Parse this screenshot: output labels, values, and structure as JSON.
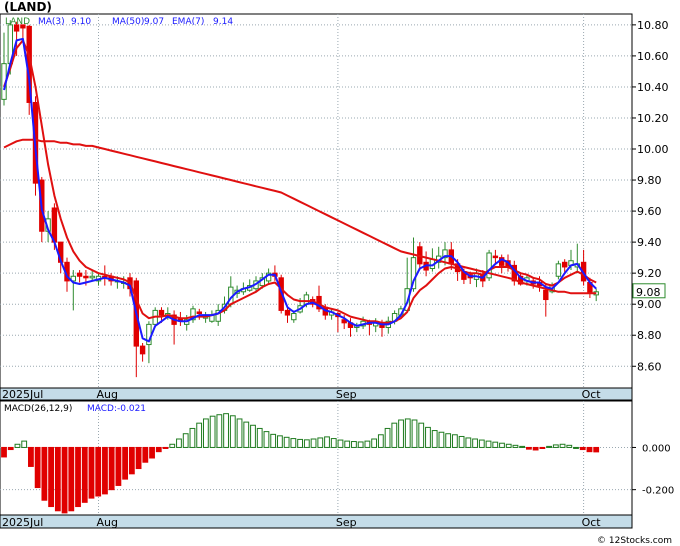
{
  "title": "(LAND)",
  "legend": {
    "symbol": "LAND",
    "ma3_label": "MA(3)",
    "ma3_value": "9.10",
    "ma50_label": "MA(50)",
    "ma50_value": "9.07",
    "ema7_label": "EMA(7)",
    "ema7_value": "9.14"
  },
  "last_price_label": "9.08",
  "macd_legend": {
    "label": "MACD(26,12,9)",
    "value_label": "MACD:-0.021"
  },
  "x_axis_labels": [
    "2025Jul",
    "Aug",
    "Sep",
    "Oct"
  ],
  "footer": "© 12Stocks.com",
  "colors": {
    "up": "#2e8b2e",
    "down": "#e00000",
    "ma3": "#1a1aff",
    "ma50": "#e01010",
    "ema7": "#e01010",
    "axis_bar": "#c4dce8",
    "grid": "#9aa8b0",
    "macd_neg": "#e00000",
    "macd_pos": "#1e7a1e"
  },
  "chart_data": [
    {
      "type": "candlestick",
      "title": "(LAND)",
      "y_ticks": [
        10.8,
        10.6,
        10.4,
        10.2,
        10.0,
        9.8,
        9.6,
        9.4,
        9.2,
        9.0,
        8.8,
        8.6
      ],
      "ylim": [
        8.46,
        10.87
      ],
      "month_labels": [
        {
          "label": "2025Jul",
          "index": 0
        },
        {
          "label": "Aug",
          "index": 15
        },
        {
          "label": "Sep",
          "index": 53
        },
        {
          "label": "Oct",
          "index": 92
        }
      ],
      "series_legend": [
        "MA(3) 9.10",
        "MA(50) 9.07",
        "EMA(7) 9.14"
      ],
      "last_price": 9.08,
      "candles": [
        [
          10.32,
          10.55,
          10.75,
          10.28
        ],
        [
          10.55,
          10.8,
          10.83,
          10.48
        ],
        [
          10.8,
          10.76,
          10.82,
          10.6
        ],
        [
          10.8,
          10.78,
          10.8,
          10.7
        ],
        [
          10.79,
          10.3,
          10.8,
          10.22
        ],
        [
          10.3,
          9.78,
          10.34,
          9.7
        ],
        [
          9.8,
          9.47,
          9.82,
          9.4
        ],
        [
          9.47,
          9.55,
          9.6,
          9.4
        ],
        [
          9.62,
          9.4,
          9.65,
          9.35
        ],
        [
          9.4,
          9.27,
          9.4,
          9.2
        ],
        [
          9.27,
          9.15,
          9.3,
          9.08
        ],
        [
          9.15,
          9.18,
          9.22,
          8.96
        ],
        [
          9.2,
          9.18,
          9.22,
          9.14
        ],
        [
          9.18,
          9.17,
          9.22,
          9.12
        ],
        [
          9.17,
          9.18,
          9.22,
          9.15
        ],
        [
          9.15,
          9.18,
          9.2,
          9.12
        ],
        [
          9.18,
          9.17,
          9.25,
          9.12
        ],
        [
          9.18,
          9.15,
          9.2,
          9.12
        ],
        [
          9.15,
          9.15,
          9.18,
          9.1
        ],
        [
          9.14,
          9.14,
          9.18,
          9.1
        ],
        [
          9.17,
          9.1,
          9.2,
          9.05
        ],
        [
          9.15,
          8.73,
          9.17,
          8.53
        ],
        [
          8.73,
          8.68,
          8.75,
          8.63
        ],
        [
          8.74,
          8.87,
          8.89,
          8.62
        ],
        [
          8.87,
          8.96,
          8.98,
          8.85
        ],
        [
          8.96,
          8.93,
          8.98,
          8.88
        ],
        [
          8.92,
          8.94,
          8.98,
          8.9
        ],
        [
          8.93,
          8.87,
          8.96,
          8.74
        ],
        [
          8.91,
          8.89,
          8.95,
          8.86
        ],
        [
          8.87,
          8.9,
          8.93,
          8.83
        ],
        [
          8.9,
          8.97,
          8.99,
          8.88
        ],
        [
          8.95,
          8.94,
          8.97,
          8.9
        ],
        [
          8.91,
          8.92,
          8.95,
          8.88
        ],
        [
          8.89,
          8.93,
          8.96,
          8.88
        ],
        [
          8.89,
          8.96,
          9.0,
          8.86
        ],
        [
          8.96,
          9.0,
          9.05,
          8.94
        ],
        [
          9.0,
          9.11,
          9.18,
          8.98
        ],
        [
          9.07,
          9.09,
          9.12,
          9.04
        ],
        [
          9.08,
          9.1,
          9.14,
          9.06
        ],
        [
          9.09,
          9.12,
          9.16,
          9.08
        ],
        [
          9.1,
          9.15,
          9.18,
          9.08
        ],
        [
          9.12,
          9.17,
          9.2,
          9.1
        ],
        [
          9.15,
          9.2,
          9.23,
          9.13
        ],
        [
          9.2,
          9.18,
          9.25,
          9.15
        ],
        [
          9.17,
          8.96,
          9.19,
          8.94
        ],
        [
          8.96,
          8.93,
          8.98,
          8.88
        ],
        [
          8.9,
          8.94,
          8.96,
          8.88
        ],
        [
          8.95,
          8.99,
          9.04,
          8.94
        ],
        [
          9.0,
          9.06,
          9.08,
          8.98
        ],
        [
          9.03,
          9.0,
          9.05,
          8.98
        ],
        [
          9.05,
          8.97,
          9.12,
          8.95
        ],
        [
          8.98,
          8.93,
          9.0,
          8.9
        ],
        [
          8.93,
          8.95,
          8.97,
          8.9
        ],
        [
          8.94,
          8.92,
          8.95,
          8.82
        ],
        [
          8.9,
          8.88,
          8.93,
          8.84
        ],
        [
          8.88,
          8.85,
          8.91,
          8.79
        ],
        [
          8.85,
          8.86,
          8.88,
          8.82
        ],
        [
          8.86,
          8.89,
          8.92,
          8.84
        ],
        [
          8.89,
          8.87,
          8.9,
          8.8
        ],
        [
          8.86,
          8.89,
          8.91,
          8.82
        ],
        [
          8.88,
          8.85,
          8.9,
          8.79
        ],
        [
          8.85,
          8.89,
          8.92,
          8.81
        ],
        [
          8.89,
          8.94,
          8.96,
          8.87
        ],
        [
          8.93,
          8.97,
          8.99,
          8.91
        ],
        [
          8.96,
          9.1,
          9.3,
          8.95
        ],
        [
          9.1,
          9.3,
          9.43,
          9.08
        ],
        [
          9.37,
          9.26,
          9.4,
          9.22
        ],
        [
          9.27,
          9.22,
          9.34,
          9.18
        ],
        [
          9.23,
          9.29,
          9.36,
          9.21
        ],
        [
          9.27,
          9.31,
          9.37,
          9.23
        ],
        [
          9.3,
          9.35,
          9.4,
          9.25
        ],
        [
          9.35,
          9.26,
          9.4,
          9.22
        ],
        [
          9.26,
          9.21,
          9.29,
          9.15
        ],
        [
          9.21,
          9.16,
          9.23,
          9.13
        ],
        [
          9.19,
          9.17,
          9.21,
          9.13
        ],
        [
          9.16,
          9.2,
          9.23,
          9.11
        ],
        [
          9.19,
          9.15,
          9.22,
          9.11
        ],
        [
          9.17,
          9.33,
          9.35,
          9.15
        ],
        [
          9.31,
          9.3,
          9.35,
          9.26
        ],
        [
          9.3,
          9.25,
          9.32,
          9.2
        ],
        [
          9.28,
          9.24,
          9.32,
          9.21
        ],
        [
          9.25,
          9.15,
          9.28,
          9.12
        ],
        [
          9.18,
          9.13,
          9.2,
          9.12
        ],
        [
          9.15,
          9.17,
          9.19,
          9.12
        ],
        [
          9.15,
          9.13,
          9.17,
          9.1
        ],
        [
          9.14,
          9.12,
          9.18,
          9.08
        ],
        [
          9.09,
          9.03,
          9.13,
          8.92
        ],
        [
          9.08,
          9.12,
          9.14,
          9.07
        ],
        [
          9.18,
          9.26,
          9.28,
          9.16
        ],
        [
          9.27,
          9.24,
          9.29,
          9.2
        ],
        [
          9.25,
          9.28,
          9.35,
          9.22
        ],
        [
          9.24,
          9.26,
          9.39,
          9.2
        ],
        [
          9.27,
          9.15,
          9.35,
          9.12
        ],
        [
          9.14,
          9.07,
          9.17,
          9.04
        ],
        [
          9.06,
          9.08,
          9.1,
          9.02
        ]
      ],
      "ma3": [
        10.38,
        10.55,
        10.7,
        10.71,
        10.45,
        10.0,
        9.61,
        9.48,
        9.4,
        9.28,
        9.18,
        9.14,
        9.13,
        9.14,
        9.15,
        9.16,
        9.17,
        9.16,
        9.15,
        9.14,
        9.12,
        8.94,
        8.78,
        8.76,
        8.86,
        8.89,
        8.92,
        8.9,
        8.89,
        8.89,
        8.91,
        8.93,
        8.93,
        8.93,
        8.94,
        8.98,
        9.04,
        9.08,
        9.1,
        9.11,
        9.13,
        9.16,
        9.19,
        9.19,
        9.08,
        8.98,
        8.95,
        8.97,
        9.0,
        9.01,
        8.99,
        8.96,
        8.95,
        8.93,
        8.91,
        8.88,
        8.86,
        8.87,
        8.88,
        8.88,
        8.87,
        8.87,
        8.89,
        8.93,
        9.01,
        9.15,
        9.23,
        9.25,
        9.25,
        9.28,
        9.31,
        9.31,
        9.27,
        9.21,
        9.18,
        9.18,
        9.17,
        9.22,
        9.26,
        9.29,
        9.27,
        9.22,
        9.17,
        9.15,
        9.14,
        9.14,
        9.11,
        9.1,
        9.14,
        9.2,
        9.25,
        9.26,
        9.2,
        9.14,
        9.1
      ],
      "ma50": [
        10.01,
        10.03,
        10.05,
        10.06,
        10.06,
        10.06,
        10.05,
        10.05,
        10.05,
        10.04,
        10.04,
        10.03,
        10.03,
        10.02,
        10.02,
        10.01,
        10.0,
        9.99,
        9.98,
        9.97,
        9.96,
        9.95,
        9.94,
        9.93,
        9.92,
        9.91,
        9.9,
        9.89,
        9.88,
        9.87,
        9.86,
        9.85,
        9.84,
        9.83,
        9.82,
        9.81,
        9.8,
        9.79,
        9.78,
        9.77,
        9.76,
        9.75,
        9.74,
        9.73,
        9.72,
        9.7,
        9.68,
        9.66,
        9.64,
        9.62,
        9.6,
        9.58,
        9.56,
        9.54,
        9.52,
        9.5,
        9.48,
        9.46,
        9.44,
        9.42,
        9.4,
        9.38,
        9.36,
        9.34,
        9.33,
        9.32,
        9.31,
        9.3,
        9.29,
        9.28,
        9.27,
        9.26,
        9.25,
        9.24,
        9.23,
        9.22,
        9.21,
        9.2,
        9.19,
        9.18,
        9.17,
        9.16,
        9.14,
        9.13,
        9.12,
        9.11,
        9.1,
        9.09,
        9.08,
        9.08,
        9.07,
        9.07,
        9.07,
        9.07,
        9.07
      ],
      "ema7": [
        10.4,
        10.52,
        10.65,
        10.7,
        10.6,
        10.4,
        10.15,
        9.9,
        9.7,
        9.55,
        9.43,
        9.34,
        9.28,
        9.24,
        9.22,
        9.2,
        9.19,
        9.18,
        9.17,
        9.16,
        9.14,
        9.03,
        8.94,
        8.91,
        8.92,
        8.92,
        8.93,
        8.92,
        8.91,
        8.91,
        8.92,
        8.92,
        8.92,
        8.93,
        8.94,
        8.96,
        9.0,
        9.02,
        9.04,
        9.06,
        9.08,
        9.11,
        9.13,
        9.14,
        9.1,
        9.06,
        9.03,
        9.02,
        9.02,
        9.02,
        9.0,
        8.98,
        8.97,
        8.96,
        8.94,
        8.92,
        8.91,
        8.9,
        8.89,
        8.89,
        8.88,
        8.88,
        8.89,
        8.91,
        8.95,
        9.04,
        9.09,
        9.12,
        9.16,
        9.2,
        9.23,
        9.24,
        9.23,
        9.21,
        9.2,
        9.2,
        9.19,
        9.22,
        9.24,
        9.24,
        9.24,
        9.22,
        9.2,
        9.19,
        9.17,
        9.16,
        9.13,
        9.12,
        9.14,
        9.17,
        9.19,
        9.21,
        9.19,
        9.16,
        9.14
      ]
    },
    {
      "type": "bar",
      "title": "MACD(26,12,9)",
      "value_label": "MACD:-0.021",
      "y_ticks": [
        0.0,
        -0.2
      ],
      "ylim": [
        -0.32,
        0.22
      ],
      "values": [
        -0.045,
        -0.01,
        0.015,
        0.03,
        -0.09,
        -0.19,
        -0.25,
        -0.28,
        -0.3,
        -0.31,
        -0.3,
        -0.28,
        -0.26,
        -0.24,
        -0.23,
        -0.22,
        -0.2,
        -0.18,
        -0.15,
        -0.125,
        -0.1,
        -0.07,
        -0.05,
        -0.02,
        -0.005,
        0.015,
        0.04,
        0.065,
        0.09,
        0.115,
        0.135,
        0.148,
        0.155,
        0.16,
        0.15,
        0.135,
        0.12,
        0.105,
        0.09,
        0.075,
        0.062,
        0.055,
        0.048,
        0.042,
        0.038,
        0.036,
        0.04,
        0.045,
        0.05,
        0.042,
        0.035,
        0.03,
        0.028,
        0.026,
        0.03,
        0.04,
        0.06,
        0.09,
        0.115,
        0.13,
        0.135,
        0.13,
        0.115,
        0.095,
        0.08,
        0.072,
        0.065,
        0.06,
        0.052,
        0.045,
        0.04,
        0.035,
        0.03,
        0.025,
        0.02,
        0.015,
        0.01,
        0.005,
        -0.008,
        -0.012,
        -0.005,
        0.005,
        0.012,
        0.015,
        0.01,
        0.0,
        -0.01,
        -0.02,
        -0.021
      ]
    }
  ]
}
